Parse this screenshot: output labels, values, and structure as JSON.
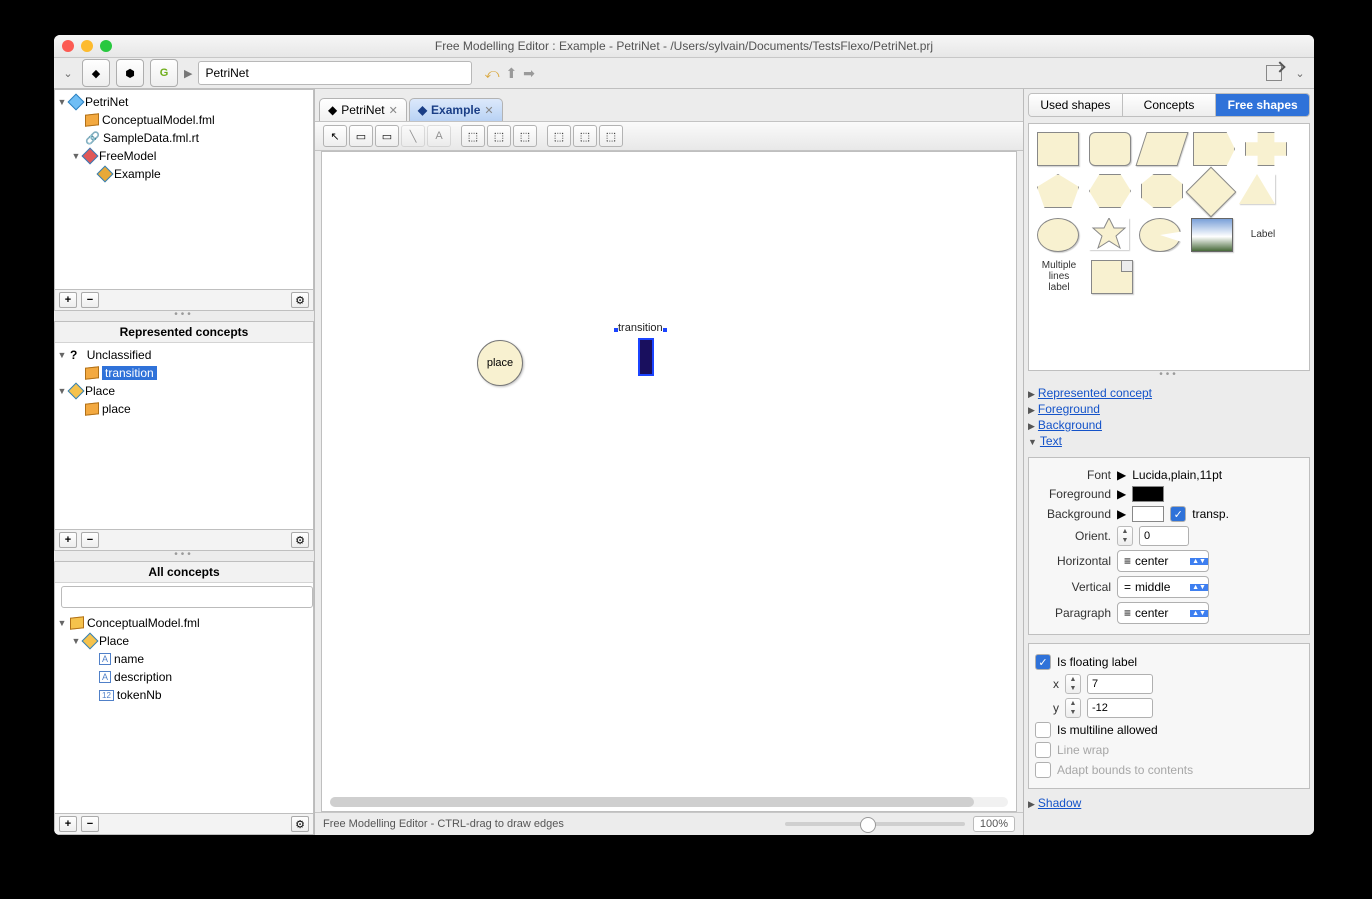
{
  "title": "Free Modelling Editor : Example - PetriNet - /Users/sylvain/Documents/TestsFlexo/PetriNet.prj",
  "breadcrumb": "PetriNet",
  "tree_top": {
    "root": "PetriNet",
    "items": [
      "ConceptualModel.fml",
      "SampleData.fml.rt",
      "FreeModel"
    ],
    "child": "Example"
  },
  "represented": {
    "title": "Represented concepts",
    "root": "Unclassified",
    "sel": "transition",
    "group": "Place",
    "child": "place"
  },
  "allconcepts": {
    "title": "All concepts",
    "root": "ConceptualModel.fml",
    "group": "Place",
    "items": [
      "name",
      "description",
      "tokenNb"
    ]
  },
  "tabs": {
    "t1": "PetriNet",
    "t2": "Example"
  },
  "canvas": {
    "place": "place",
    "transition": "transition"
  },
  "status": "Free Modelling Editor - CTRL-drag to draw edges",
  "zoom": "100%",
  "rtabs": {
    "a": "Used shapes",
    "b": "Concepts",
    "c": "Free shapes"
  },
  "shape_label": "Label",
  "shape_mlabel": "Multiple lines label",
  "sections": {
    "rep": "Represented concept",
    "fg": "Foreground",
    "bg": "Background",
    "txt": "Text",
    "shadow": "Shadow"
  },
  "text": {
    "font_lbl": "Font",
    "font_val": "Lucida,plain,11pt",
    "fg_lbl": "Foreground",
    "bg_lbl": "Background",
    "transp": "transp.",
    "orient_lbl": "Orient.",
    "orient_val": "0",
    "horiz_lbl": "Horizontal",
    "horiz_val": "center",
    "vert_lbl": "Vertical",
    "vert_val": "middle",
    "para_lbl": "Paragraph",
    "para_val": "center"
  },
  "float": {
    "lbl": "Is floating label",
    "x_lbl": "x",
    "x_val": "7",
    "y_lbl": "y",
    "y_val": "-12",
    "ml": "Is multiline allowed",
    "lw": "Line wrap",
    "ab": "Adapt bounds to contents"
  }
}
